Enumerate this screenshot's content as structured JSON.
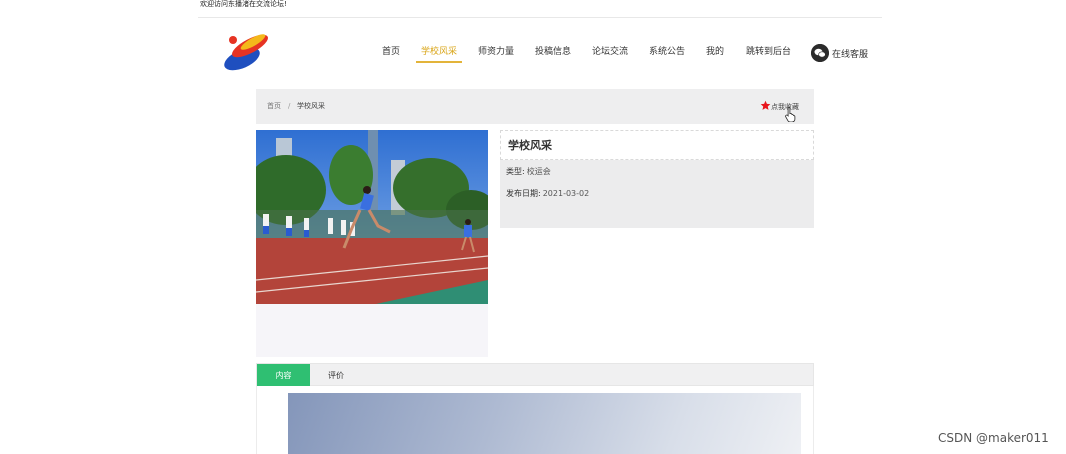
{
  "topbar": {
    "welcome": "欢迎访问东播渚在交流论坛!"
  },
  "nav": {
    "items": [
      {
        "label": "首页"
      },
      {
        "label": "学校风采"
      },
      {
        "label": "师资力量"
      },
      {
        "label": "投稿信息"
      },
      {
        "label": "论坛交流"
      },
      {
        "label": "系统公告"
      },
      {
        "label": "我的"
      },
      {
        "label": "跳转到后台"
      }
    ],
    "active": "学校风采",
    "service_label": "在线客服"
  },
  "breadcrumb": {
    "home": "首页",
    "separator": "/",
    "current": "学校风采"
  },
  "favorite": {
    "label": "点我收藏",
    "icon": "star-icon",
    "color": "#e8141b"
  },
  "detail": {
    "title": "学校风采",
    "type_label": "类型:",
    "type_value": "校运会",
    "date_label": "发布日期:",
    "date_value": "2021-03-02"
  },
  "tabs": [
    {
      "label": "内容"
    },
    {
      "label": "评价"
    }
  ],
  "colors": {
    "accent": "#2fbf72",
    "nav_active": "#d9a415"
  },
  "watermark": "CSDN @maker011"
}
